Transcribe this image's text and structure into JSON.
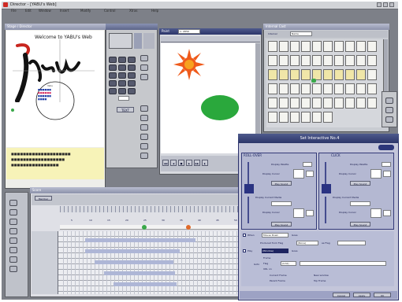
{
  "app": {
    "title": "Director - [YABU's Web]",
    "menu": [
      "File",
      "Edit",
      "Window",
      "Insert",
      "Modify",
      "Control",
      "Xtras",
      "Help"
    ]
  },
  "stage": {
    "title": "Stage / Director",
    "welcome": "Welcome to YABU's Web",
    "logo": "Yabu",
    "bullets": [
      "■■■■■■",
      "■■■■■■",
      "■■■■■■",
      "■■■■"
    ],
    "caption_lines": [
      "■■■■■■■■■■■■■■■■■■■■",
      "■■■■■■■■■■■■■■■■■■",
      "■■■■■■■■■■■■■■■■"
    ]
  },
  "paint": {
    "title": "Paint",
    "field_value": "1: 2D50",
    "text_button": "TEXT",
    "control_buttons": [
      "◀◀",
      "◀",
      "■",
      "▶",
      "▶▶",
      "◐"
    ]
  },
  "cast": {
    "title": "Internal Cast",
    "sort_label": "Internal",
    "sort_value": "Name"
  },
  "behavior": {
    "title": "Set Interactive No.4",
    "rollover": {
      "header": "ROLL-OVER",
      "display_label": "Display Palette",
      "cursor_label": "Display Cursor",
      "play_button": "Play Sound",
      "media_label": "Display Current Media",
      "cursor2_label": "Display Cursor",
      "play2_button": "Play Sound"
    },
    "click": {
      "header": "CLICK",
      "display_label": "Display Palette",
      "cursor_label": "Display Cursor",
      "play_button": "Play Sound",
      "media_label": "Display Current Media",
      "cursor2_label": "Display Cursor",
      "play2_button": "Play Sound"
    },
    "when": {
      "label": "When",
      "value": "Mouse Down",
      "suffix": "Goes"
    },
    "from": {
      "label": "Produced from Flag",
      "value": "(None)",
      "to_label": "as Flag",
      "to_value": ""
    },
    "play": {
      "label": "Play",
      "value": "(Window)",
      "suffix": "Goes"
    },
    "goto": {
      "label": "Goto",
      "options": [
        "Frame",
        "Flag",
        "URL on"
      ],
      "flag_value": "(Link)",
      "checkboxes": [
        "Current Frame",
        "New window",
        "Parent Frame",
        "Top Frame"
      ]
    },
    "footer": [
      "Cancel",
      "Apply",
      "OK"
    ]
  },
  "score": {
    "title": "Score",
    "channel_tab": "Member",
    "frame_numbers": [
      "5",
      "10",
      "15",
      "20",
      "25",
      "30",
      "35",
      "40",
      "45",
      "50"
    ]
  }
}
